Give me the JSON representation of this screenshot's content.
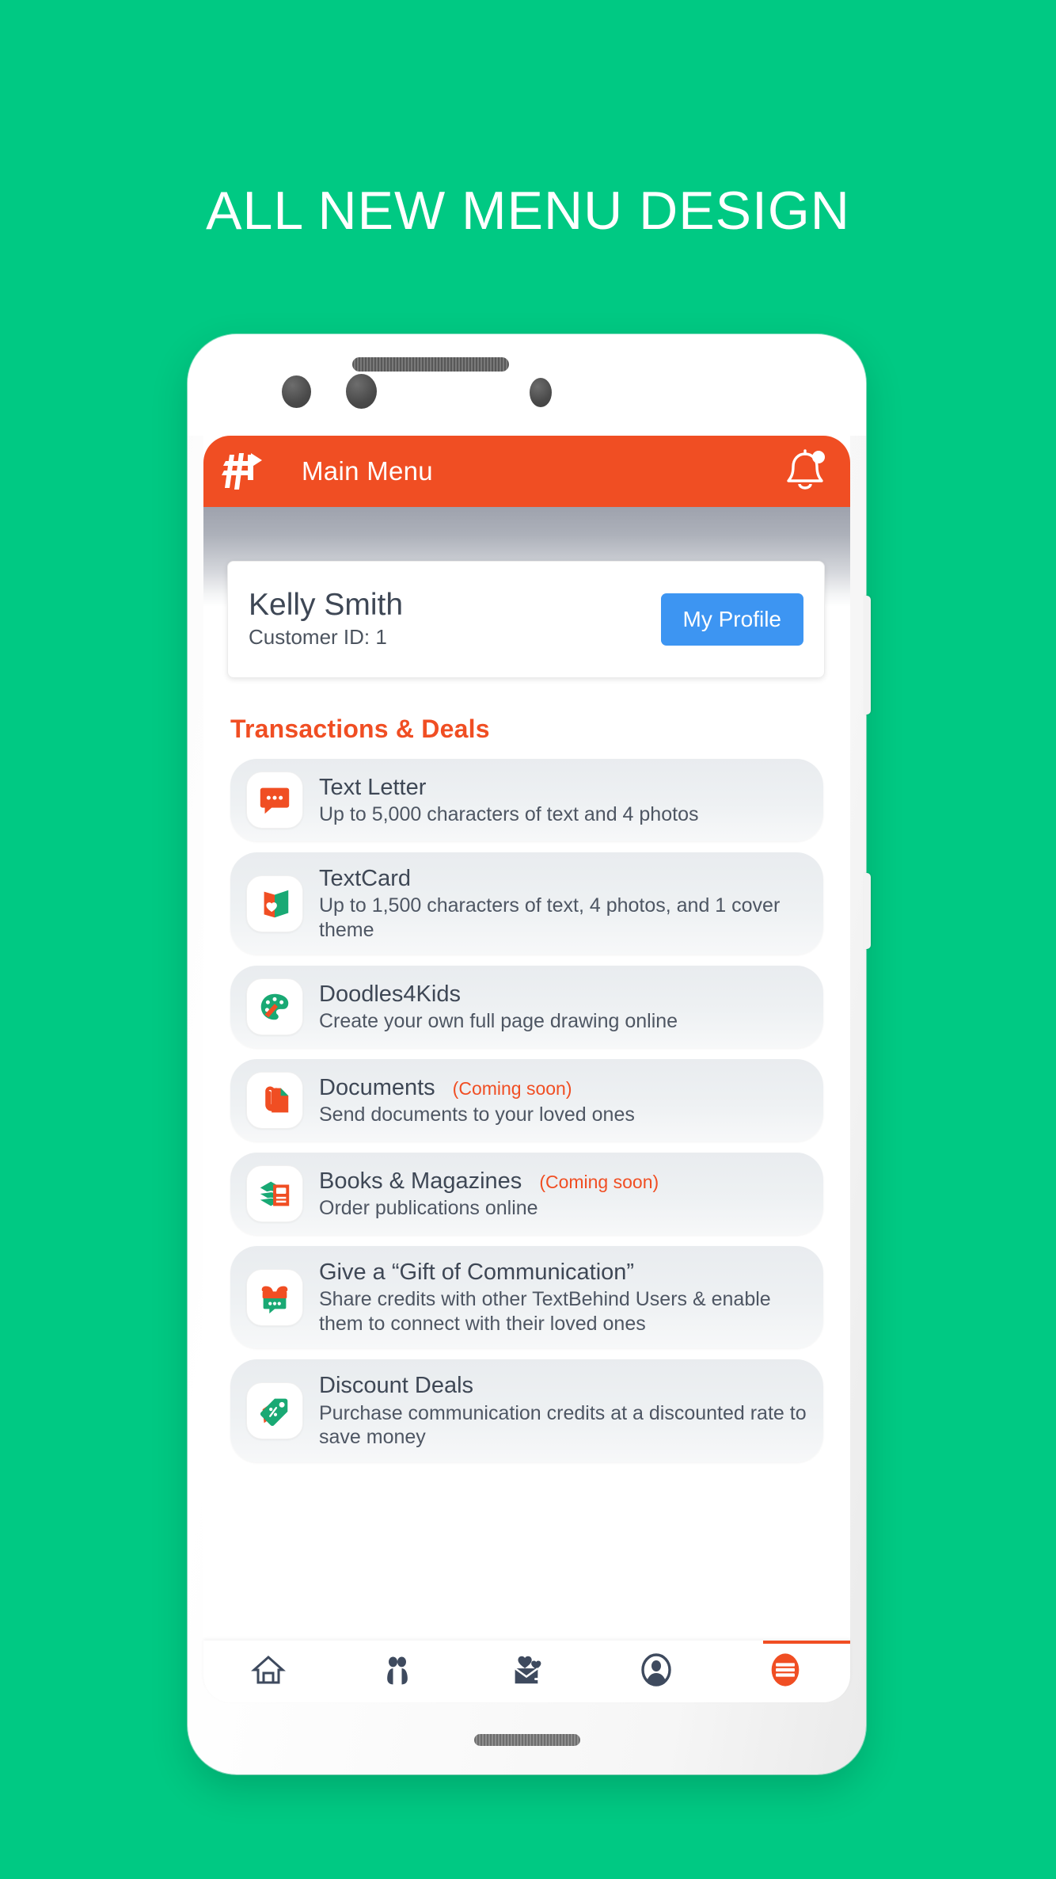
{
  "page": {
    "headline": "ALL NEW MENU DESIGN",
    "background_color": "#00c983"
  },
  "appbar": {
    "title": "Main Menu",
    "brand_icon": "textbehind-logo-icon",
    "notification_icon": "bell-icon",
    "background_color": "#f04e23",
    "has_notification_dot": true
  },
  "profile": {
    "name": "Kelly Smith",
    "customer_id_label": "Customer ID:  1",
    "button_label": "My Profile",
    "button_color": "#3d95f2"
  },
  "section": {
    "title": "Transactions & Deals",
    "title_color": "#f04e23"
  },
  "menu_items": [
    {
      "title": "Text Letter",
      "subtitle": "Up to 5,000 characters of text and 4 photos",
      "badge": "",
      "icon": "chat-bubble-icon"
    },
    {
      "title": "TextCard",
      "subtitle": "Up to 1,500 characters of text, 4 photos, and 1 cover theme",
      "badge": "",
      "icon": "greeting-card-heart-icon"
    },
    {
      "title": "Doodles4Kids",
      "subtitle": "Create your own full page drawing online",
      "badge": "",
      "icon": "paint-palette-icon"
    },
    {
      "title": "Documents",
      "subtitle": "Send documents to your loved ones",
      "badge": "(Coming soon)",
      "icon": "paperclip-document-icon"
    },
    {
      "title": "Books & Magazines",
      "subtitle": "Order publications online",
      "badge": "(Coming soon)",
      "icon": "books-magazines-icon"
    },
    {
      "title": "Give a “Gift of Communication”",
      "subtitle": "Share credits with other TextBehind Users & enable them to connect with their loved ones",
      "badge": "",
      "icon": "gift-chat-icon"
    },
    {
      "title": "Discount Deals",
      "subtitle": "Purchase communication credits at a discounted rate to save money",
      "badge": "",
      "icon": "price-tag-percent-icon"
    }
  ],
  "bottom_nav": [
    {
      "icon": "home-icon",
      "active": false
    },
    {
      "icon": "contacts-people-icon",
      "active": false
    },
    {
      "icon": "mail-heart-icon",
      "active": false
    },
    {
      "icon": "account-circle-icon",
      "active": false
    },
    {
      "icon": "hamburger-menu-icon",
      "active": true
    }
  ]
}
